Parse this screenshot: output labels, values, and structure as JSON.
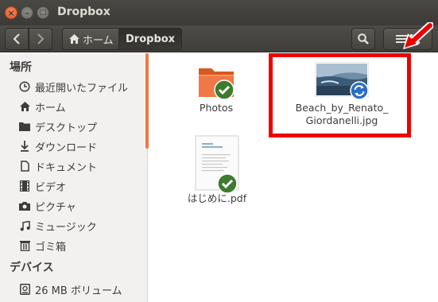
{
  "window": {
    "title": "Dropbox",
    "close_glyph": "×",
    "min_glyph": "–",
    "max_glyph": "□"
  },
  "toolbar": {
    "back_icon": "chevron-left-icon",
    "forward_icon": "chevron-right-icon",
    "breadcrumb": [
      {
        "label": "ホーム",
        "icon": "home-icon"
      },
      {
        "label": "Dropbox"
      }
    ],
    "search_icon": "search-icon",
    "view_icon": "list-grid-icon"
  },
  "sidebar": {
    "sections": [
      {
        "title": "場所",
        "items": [
          {
            "label": "最近開いたファイル",
            "icon": "clock-icon"
          },
          {
            "label": "ホーム",
            "icon": "home-icon"
          },
          {
            "label": "デスクトップ",
            "icon": "desktop-icon"
          },
          {
            "label": "ダウンロード",
            "icon": "download-icon"
          },
          {
            "label": "ドキュメント",
            "icon": "document-icon"
          },
          {
            "label": "ビデオ",
            "icon": "film-icon"
          },
          {
            "label": "ピクチャ",
            "icon": "camera-icon"
          },
          {
            "label": "ミュージック",
            "icon": "music-icon"
          },
          {
            "label": "ゴミ箱",
            "icon": "trash-icon"
          }
        ]
      },
      {
        "title": "デバイス",
        "items": [
          {
            "label": "26 MB ボリューム",
            "icon": "drive-icon"
          }
        ]
      }
    ]
  },
  "files": [
    {
      "name": "Photos",
      "type": "folder",
      "status": "synced"
    },
    {
      "name_line1": "Beach_by_Renato_",
      "name_line2": "Giordanelli.jpg",
      "type": "image",
      "status": "syncing"
    },
    {
      "name": "はじめに.pdf",
      "type": "pdf",
      "status": "synced"
    }
  ],
  "colors": {
    "accent_orange": "#e95420",
    "sync_green": "#3d7b2f",
    "sync_blue": "#2b6fc4",
    "highlight_red": "#e00000"
  }
}
